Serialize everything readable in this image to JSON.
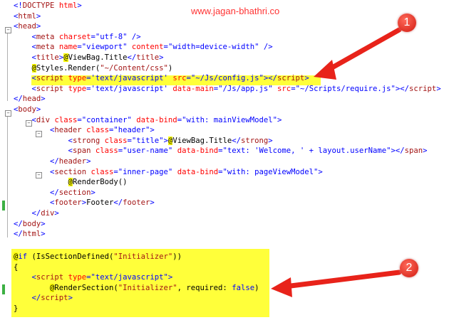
{
  "watermark": "www.jagan-bhathri.co",
  "badges": [
    "1",
    "2"
  ],
  "colors": {
    "highlight": "#ffff3a",
    "arrow": "#e8231a",
    "tag": "#a31515",
    "attribute": "#ff0000",
    "attr_value": "#0000ff",
    "change_bar": "#3cb043"
  },
  "lines": [
    [
      [
        "br",
        "<!"
      ],
      [
        "tag",
        "DOCTYPE"
      ],
      [
        "txt",
        " "
      ],
      [
        "attr",
        "html"
      ],
      [
        "br",
        ">"
      ]
    ],
    [
      [
        "br",
        "<"
      ],
      [
        "tag",
        "html"
      ],
      [
        "br",
        ">"
      ]
    ],
    [
      [
        "br",
        "<"
      ],
      [
        "tag",
        "head"
      ],
      [
        "br",
        ">"
      ]
    ],
    [
      [
        "txt",
        "    "
      ],
      [
        "br",
        "<"
      ],
      [
        "tag",
        "meta"
      ],
      [
        "txt",
        " "
      ],
      [
        "attr",
        "charset"
      ],
      [
        "br",
        "="
      ],
      [
        "val",
        "\"utf-8\""
      ],
      [
        "txt",
        " "
      ],
      [
        "br",
        "/>"
      ]
    ],
    [
      [
        "txt",
        "    "
      ],
      [
        "br",
        "<"
      ],
      [
        "tag",
        "meta"
      ],
      [
        "txt",
        " "
      ],
      [
        "attr",
        "name"
      ],
      [
        "br",
        "="
      ],
      [
        "val",
        "\"viewport\""
      ],
      [
        "txt",
        " "
      ],
      [
        "attr",
        "content"
      ],
      [
        "br",
        "="
      ],
      [
        "val",
        "\"width=device-width\""
      ],
      [
        "txt",
        " "
      ],
      [
        "br",
        "/>"
      ]
    ],
    [
      [
        "txt",
        "    "
      ],
      [
        "br",
        "<"
      ],
      [
        "tag",
        "title"
      ],
      [
        "br",
        ">"
      ],
      [
        "razor",
        "@"
      ],
      [
        "txt",
        "ViewBag.Title"
      ],
      [
        "br",
        "</"
      ],
      [
        "tag",
        "title"
      ],
      [
        "br",
        ">"
      ]
    ],
    [
      [
        "txt",
        "    "
      ],
      [
        "razor",
        "@"
      ],
      [
        "txt",
        "Styles.Render("
      ],
      [
        "str",
        "\"~/Content/css\""
      ],
      [
        "txt",
        ")"
      ]
    ],
    [
      [
        "txt",
        "    "
      ],
      [
        "br",
        "<"
      ],
      [
        "tag",
        "script"
      ],
      [
        "txt",
        " "
      ],
      [
        "attr",
        "type"
      ],
      [
        "br",
        "="
      ],
      [
        "val",
        "'text/javascript'"
      ],
      [
        "txt",
        " "
      ],
      [
        "attr",
        "src"
      ],
      [
        "br",
        "="
      ],
      [
        "val",
        "\"~/Js/config.js\""
      ],
      [
        "br",
        "></"
      ],
      [
        "tag",
        "script"
      ],
      [
        "br",
        ">"
      ]
    ],
    [
      [
        "txt",
        "    "
      ],
      [
        "br",
        "<"
      ],
      [
        "tag",
        "script"
      ],
      [
        "txt",
        " "
      ],
      [
        "attr",
        "type"
      ],
      [
        "br",
        "="
      ],
      [
        "val",
        "'text/javascript'"
      ],
      [
        "txt",
        " "
      ],
      [
        "attr",
        "data-main"
      ],
      [
        "br",
        "="
      ],
      [
        "val",
        "\"/Js/app.js\""
      ],
      [
        "txt",
        " "
      ],
      [
        "attr",
        "src"
      ],
      [
        "br",
        "="
      ],
      [
        "val",
        "\"~/Scripts/require.js\""
      ],
      [
        "br",
        "></"
      ],
      [
        "tag",
        "script"
      ],
      [
        "br",
        ">"
      ]
    ],
    [
      [
        "br",
        "</"
      ],
      [
        "tag",
        "head"
      ],
      [
        "br",
        ">"
      ]
    ],
    [
      [
        "br",
        "<"
      ],
      [
        "tag",
        "body"
      ],
      [
        "br",
        ">"
      ]
    ],
    [
      [
        "txt",
        "    "
      ],
      [
        "br",
        "<"
      ],
      [
        "tag",
        "div"
      ],
      [
        "txt",
        " "
      ],
      [
        "attr",
        "class"
      ],
      [
        "br",
        "="
      ],
      [
        "val",
        "\"container\""
      ],
      [
        "txt",
        " "
      ],
      [
        "attr",
        "data-bind"
      ],
      [
        "br",
        "="
      ],
      [
        "val",
        "\"with: mainViewModel\""
      ],
      [
        "br",
        ">"
      ]
    ],
    [
      [
        "txt",
        "        "
      ],
      [
        "br",
        "<"
      ],
      [
        "tag",
        "header"
      ],
      [
        "txt",
        " "
      ],
      [
        "attr",
        "class"
      ],
      [
        "br",
        "="
      ],
      [
        "val",
        "\"header\""
      ],
      [
        "br",
        ">"
      ]
    ],
    [
      [
        "txt",
        "            "
      ],
      [
        "br",
        "<"
      ],
      [
        "tag",
        "strong"
      ],
      [
        "txt",
        " "
      ],
      [
        "attr",
        "class"
      ],
      [
        "br",
        "="
      ],
      [
        "val",
        "\"title\""
      ],
      [
        "br",
        ">"
      ],
      [
        "razor",
        "@"
      ],
      [
        "txt",
        "ViewBag.Title"
      ],
      [
        "br",
        "</"
      ],
      [
        "tag",
        "strong"
      ],
      [
        "br",
        ">"
      ]
    ],
    [
      [
        "txt",
        "            "
      ],
      [
        "br",
        "<"
      ],
      [
        "tag",
        "span"
      ],
      [
        "txt",
        " "
      ],
      [
        "attr",
        "class"
      ],
      [
        "br",
        "="
      ],
      [
        "val",
        "\"user-name\""
      ],
      [
        "txt",
        " "
      ],
      [
        "attr",
        "data-bind"
      ],
      [
        "br",
        "="
      ],
      [
        "val",
        "\"text: 'Welcome, ' + layout.userName\""
      ],
      [
        "br",
        "></"
      ],
      [
        "tag",
        "span"
      ],
      [
        "br",
        ">"
      ]
    ],
    [
      [
        "txt",
        "        "
      ],
      [
        "br",
        "</"
      ],
      [
        "tag",
        "header"
      ],
      [
        "br",
        ">"
      ]
    ],
    [
      [
        "txt",
        "        "
      ],
      [
        "br",
        "<"
      ],
      [
        "tag",
        "section"
      ],
      [
        "txt",
        " "
      ],
      [
        "attr",
        "class"
      ],
      [
        "br",
        "="
      ],
      [
        "val",
        "\"inner-page\""
      ],
      [
        "txt",
        " "
      ],
      [
        "attr",
        "data-bind"
      ],
      [
        "br",
        "="
      ],
      [
        "val",
        "\"with: pageViewModel\""
      ],
      [
        "br",
        ">"
      ]
    ],
    [
      [
        "txt",
        "            "
      ],
      [
        "razor",
        "@"
      ],
      [
        "txt",
        "RenderBody()"
      ]
    ],
    [
      [
        "txt",
        "        "
      ],
      [
        "br",
        "</"
      ],
      [
        "tag",
        "section"
      ],
      [
        "br",
        ">"
      ]
    ],
    [
      [
        "txt",
        "        "
      ],
      [
        "br",
        "<"
      ],
      [
        "tag",
        "footer"
      ],
      [
        "br",
        ">"
      ],
      [
        "txt",
        "Footer"
      ],
      [
        "br",
        "</"
      ],
      [
        "tag",
        "footer"
      ],
      [
        "br",
        ">"
      ]
    ],
    [
      [
        "txt",
        "    "
      ],
      [
        "br",
        "</"
      ],
      [
        "tag",
        "div"
      ],
      [
        "br",
        ">"
      ]
    ],
    [
      [
        "br",
        "</"
      ],
      [
        "tag",
        "body"
      ],
      [
        "br",
        ">"
      ]
    ],
    [
      [
        "br",
        "</"
      ],
      [
        "tag",
        "html"
      ],
      [
        "br",
        ">"
      ]
    ]
  ],
  "section_lines": [
    [
      [
        "razor",
        "@"
      ],
      [
        "kw",
        "if"
      ],
      [
        "txt",
        " (IsSectionDefined("
      ],
      [
        "str",
        "\"Initializer\""
      ],
      [
        "txt",
        "))"
      ]
    ],
    [
      [
        "txt",
        "{"
      ]
    ],
    [
      [
        "txt",
        "    "
      ],
      [
        "br",
        "<"
      ],
      [
        "tag",
        "script"
      ],
      [
        "txt",
        " "
      ],
      [
        "attr",
        "type"
      ],
      [
        "br",
        "="
      ],
      [
        "val",
        "\"text/javascript\""
      ],
      [
        "br",
        ">"
      ]
    ],
    [
      [
        "txt",
        "        "
      ],
      [
        "razor",
        "@"
      ],
      [
        "txt",
        "RenderSection("
      ],
      [
        "str",
        "\"Initializer\""
      ],
      [
        "txt",
        ", required: "
      ],
      [
        "kw",
        "false"
      ],
      [
        "txt",
        ")"
      ]
    ],
    [
      [
        "txt",
        "    "
      ],
      [
        "br",
        "</"
      ],
      [
        "tag",
        "script"
      ],
      [
        "br",
        ">"
      ]
    ],
    [
      [
        "txt",
        "}"
      ]
    ]
  ]
}
